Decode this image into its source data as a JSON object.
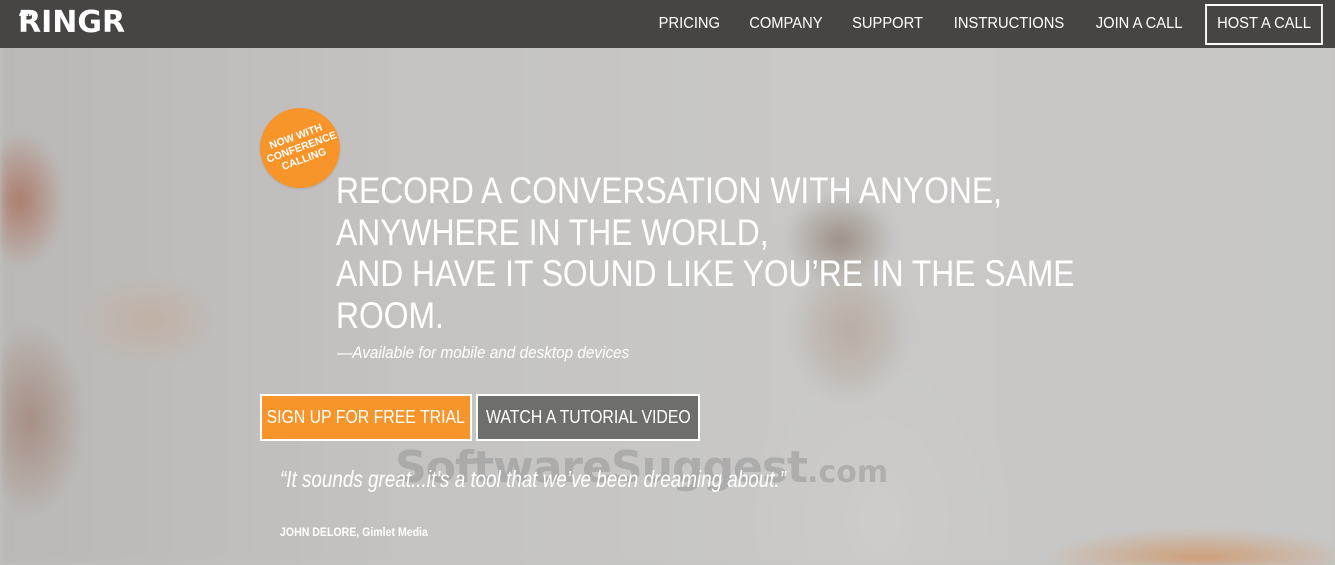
{
  "header": {
    "logo": "RINGR",
    "nav": [
      {
        "label": "PRICING"
      },
      {
        "label": "COMPANY"
      },
      {
        "label": "SUPPORT"
      },
      {
        "label": "INSTRUCTIONS"
      },
      {
        "label": "JOIN A CALL"
      }
    ],
    "host_button": "HOST A CALL"
  },
  "hero": {
    "badge": [
      "NOW WITH",
      "CONFERENCE",
      "CALLING"
    ],
    "headline": [
      "RECORD A CONVERSATION WITH ANYONE,",
      "ANYWHERE IN THE WORLD,",
      "AND HAVE IT SOUND LIKE YOU’RE IN THE SAME",
      "ROOM."
    ],
    "subline": "—Available for mobile and desktop devices",
    "primary_cta": "SIGN UP FOR FREE TRIAL",
    "secondary_cta": "WATCH A TUTORIAL VIDEO",
    "quote": "“It sounds great...it’s a tool that we’ve been dreaming about.”",
    "attribution": "JOHN DELORE, Gimlet Media"
  },
  "watermark": {
    "main": "SoftwareSuggest",
    "tld": ".com"
  },
  "colors": {
    "nav_bg": "#474544",
    "accent": "#f7942a",
    "secondary_btn": "#6e6e6c"
  }
}
